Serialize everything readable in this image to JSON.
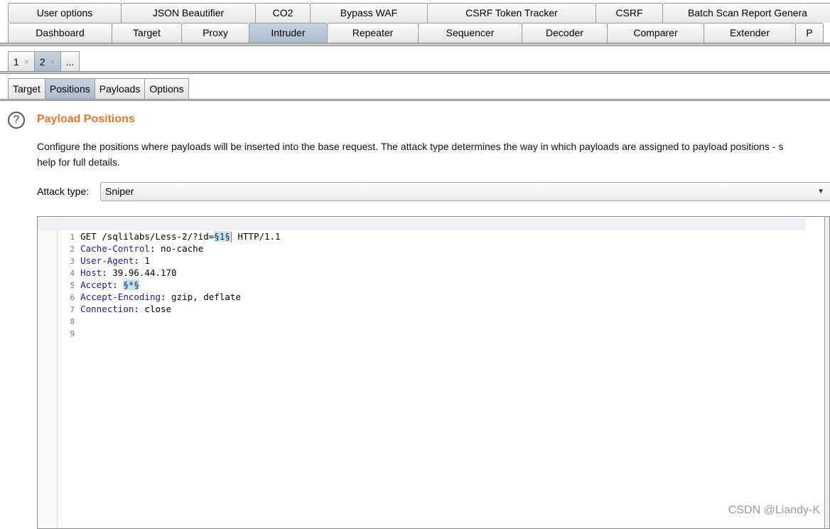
{
  "top_tabs_row1": [
    "User options",
    "JSON Beautifier",
    "CO2",
    "Bypass WAF",
    "CSRF Token Tracker",
    "CSRF",
    "Batch Scan Report Genera"
  ],
  "top_tabs_row2": [
    "Dashboard",
    "Target",
    "Proxy",
    "Intruder",
    "Repeater",
    "Sequencer",
    "Decoder",
    "Comparer",
    "Extender",
    "P"
  ],
  "active_top_tab": "Intruder",
  "attack_tabs": [
    {
      "label": "1",
      "close": "×"
    },
    {
      "label": "2",
      "close": "×"
    },
    {
      "label": "..."
    }
  ],
  "intruder_tabs": [
    "Target",
    "Positions",
    "Payloads",
    "Options"
  ],
  "active_intruder_tab": "Positions",
  "section": {
    "icon": "?",
    "title": "Payload Positions",
    "description_line1": "Configure the positions where payloads will be inserted into the base request. The attack type determines the way in which payloads are assigned to payload positions - s",
    "description_line2": "help for full details."
  },
  "attack_type": {
    "label": "Attack type:",
    "value": "Sniper"
  },
  "request_lines": [
    {
      "num": "1",
      "before": "GET /sqlilabs/Less-2/?id=",
      "marker": "§1§",
      "after": " HTTP/1.1"
    },
    {
      "num": "2",
      "key": "Cache-Control",
      "value": " no-cache"
    },
    {
      "num": "3",
      "key": "User-Agent",
      "value": " 1"
    },
    {
      "num": "4",
      "key": "Host",
      "value": " 39.96.44.170"
    },
    {
      "num": "5",
      "key": "Accept",
      "marker": "§*§"
    },
    {
      "num": "6",
      "key": "Accept-Encoding",
      "value": " gzip, deflate"
    },
    {
      "num": "7",
      "key": "Connection",
      "value": " close"
    },
    {
      "num": "8"
    },
    {
      "num": "9"
    }
  ],
  "watermark": "CSDN @Liandy-K",
  "colors": {
    "accent": "#e8762b",
    "active_tab": "#aebbcc",
    "payload_marker": "#c6e6e0"
  }
}
